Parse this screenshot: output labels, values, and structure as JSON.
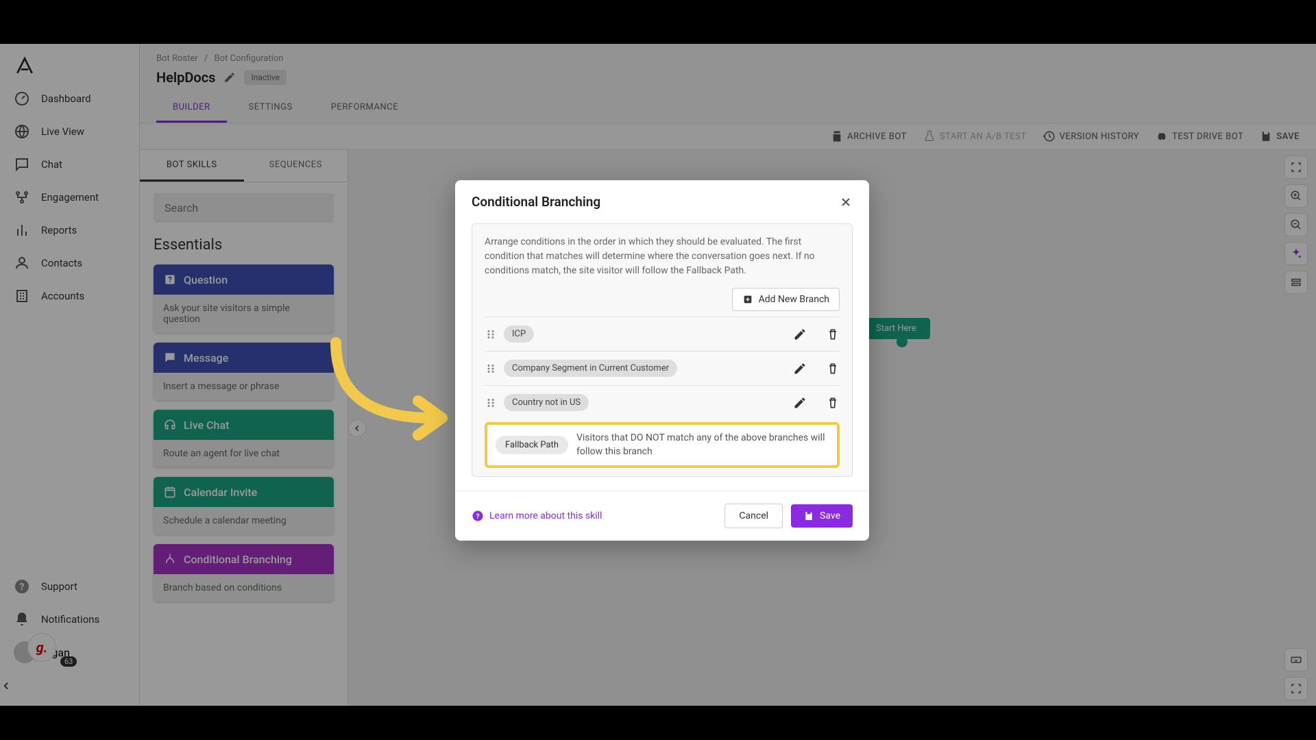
{
  "sidebar": {
    "items": [
      {
        "label": "Dashboard"
      },
      {
        "label": "Live View"
      },
      {
        "label": "Chat"
      },
      {
        "label": "Engagement"
      },
      {
        "label": "Reports"
      },
      {
        "label": "Contacts"
      },
      {
        "label": "Accounts"
      }
    ],
    "bottom": [
      {
        "label": "Support"
      },
      {
        "label": "Notifications"
      }
    ],
    "user": "Ngan",
    "badge": "63"
  },
  "breadcrumb": {
    "root": "Bot Roster",
    "sep": "/",
    "current": "Bot Configuration"
  },
  "page": {
    "title": "HelpDocs",
    "status": "Inactive"
  },
  "main_tabs": [
    "BUILDER",
    "SETTINGS",
    "PERFORMANCE"
  ],
  "toolbar": {
    "archive": "ARCHIVE BOT",
    "ab": "START AN A/B TEST",
    "history": "VERSION HISTORY",
    "test": "TEST DRIVE BOT",
    "save": "SAVE"
  },
  "skills": {
    "tabs": [
      "BOT SKILLS",
      "SEQUENCES"
    ],
    "search_placeholder": "Search",
    "section": "Essentials",
    "cards": [
      {
        "title": "Question",
        "desc": "Ask your site visitors a simple question"
      },
      {
        "title": "Message",
        "desc": "Insert a message or phrase"
      },
      {
        "title": "Live Chat",
        "desc": "Route an agent for live chat"
      },
      {
        "title": "Calendar Invite",
        "desc": "Schedule a calendar meeting"
      },
      {
        "title": "Conditional Branching",
        "desc": "Branch based on conditions"
      }
    ]
  },
  "canvas": {
    "start": "Start Here"
  },
  "modal": {
    "title": "Conditional Branching",
    "description": "Arrange conditions in the order in which they should be evaluated. The first condition that matches will determine where the conversation goes next. If no conditions match, the site visitor will follow the Fallback Path.",
    "add_btn": "Add New Branch",
    "branches": [
      {
        "label": "ICP"
      },
      {
        "label": "Company Segment in Current Customer"
      },
      {
        "label": "Country not in US"
      }
    ],
    "fallback": {
      "chip": "Fallback Path",
      "text": "Visitors that DO NOT match any of the above branches will follow this branch"
    },
    "help": "Learn more about this skill",
    "cancel": "Cancel",
    "save": "Save"
  }
}
